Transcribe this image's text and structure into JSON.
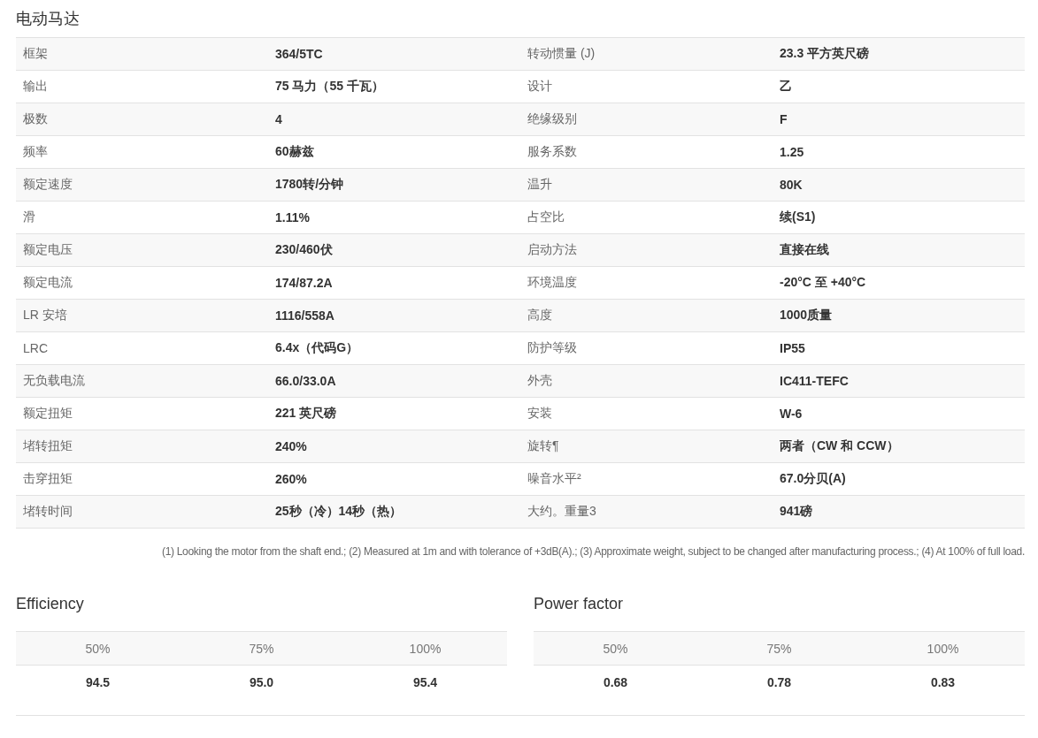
{
  "title": "电动马达",
  "specs": [
    {
      "label_1": "框架",
      "value_1": "364/5TC",
      "label_2": "转动惯量 (J)",
      "value_2": "23.3 平方英尺磅"
    },
    {
      "label_1": "输出",
      "value_1": "75 马力（55 千瓦）",
      "label_2": "设计",
      "value_2": "乙"
    },
    {
      "label_1": "极数",
      "value_1": "4",
      "label_2": "绝缘级别",
      "value_2": "F"
    },
    {
      "label_1": "频率",
      "value_1": "60赫兹",
      "label_2": "服务系数",
      "value_2": "1.25"
    },
    {
      "label_1": "额定速度",
      "value_1": "1780转/分钟",
      "label_2": "温升",
      "value_2": "80K"
    },
    {
      "label_1": "滑",
      "value_1": "1.11%",
      "label_2": "占空比",
      "value_2": "续(S1)"
    },
    {
      "label_1": "额定电压",
      "value_1": "230/460伏",
      "label_2": "启动方法",
      "value_2": "直接在线"
    },
    {
      "label_1": "额定电流",
      "value_1": "174/87.2A",
      "label_2": "环境温度",
      "value_2": "-20°C 至 +40°C"
    },
    {
      "label_1": "LR 安培",
      "value_1": "1116/558A",
      "label_2": "高度",
      "value_2": "1000质量"
    },
    {
      "label_1": "LRC",
      "value_1": "6.4x（代码G）",
      "label_2": "防护等级",
      "value_2": "IP55"
    },
    {
      "label_1": "无负载电流",
      "value_1": "66.0/33.0A",
      "label_2": "外壳",
      "value_2": "IC411-TEFC"
    },
    {
      "label_1": "额定扭矩",
      "value_1": "221 英尺磅",
      "label_2": "安装",
      "value_2": "W-6"
    },
    {
      "label_1": "堵转扭矩",
      "value_1": "240%",
      "label_2": "旋转¶",
      "value_2": "两者（CW 和 CCW）"
    },
    {
      "label_1": "击穿扭矩",
      "value_1": "260%",
      "label_2": "噪音水平²",
      "value_2": "67.0分贝(A)"
    },
    {
      "label_1": "堵转时间",
      "value_1": "25秒（冷）14秒（热）",
      "label_2": "大约。重量3",
      "value_2": "941磅"
    }
  ],
  "footnote": "(1) Looking the motor from the shaft end.; (2) Measured at 1m and with tolerance of +3dB(A).; (3) Approximate weight, subject to be changed after manufacturing process.; (4) At 100% of full load.",
  "load_tables": [
    {
      "title": "Efficiency",
      "columns": [
        "50%",
        "75%",
        "100%"
      ],
      "values": [
        "94.5",
        "95.0",
        "95.4"
      ]
    },
    {
      "title": "Power factor",
      "columns": [
        "50%",
        "75%",
        "100%"
      ],
      "values": [
        "0.68",
        "0.78",
        "0.83"
      ]
    }
  ]
}
